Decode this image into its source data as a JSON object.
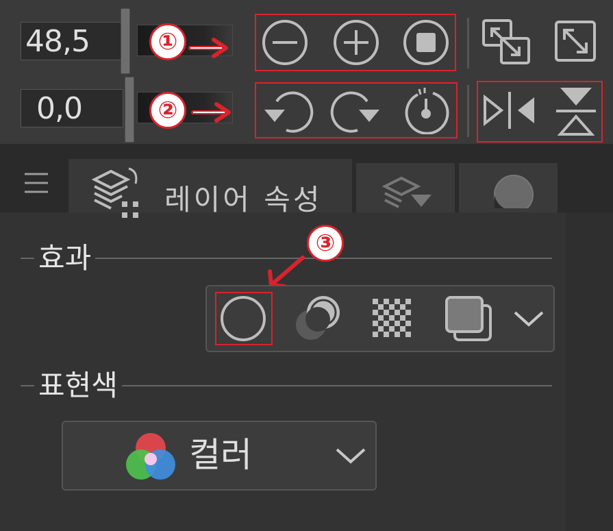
{
  "toolbar": {
    "scale_value": "48,5",
    "rotate_value": "0,0"
  },
  "annotations": {
    "one": "①",
    "two": "②",
    "three": "③"
  },
  "tabs": {
    "menu_icon": "hamburger-icon",
    "active_label": "레이어 속성"
  },
  "sections": {
    "effect": {
      "label": "효과"
    },
    "expression_color": {
      "label": "표현색"
    }
  },
  "color_dropdown": {
    "selected": "컬러"
  },
  "colors": {
    "annotation_red": "#d9232d",
    "panel_bg": "#333333",
    "icon_gray": "#bdbdbd"
  }
}
